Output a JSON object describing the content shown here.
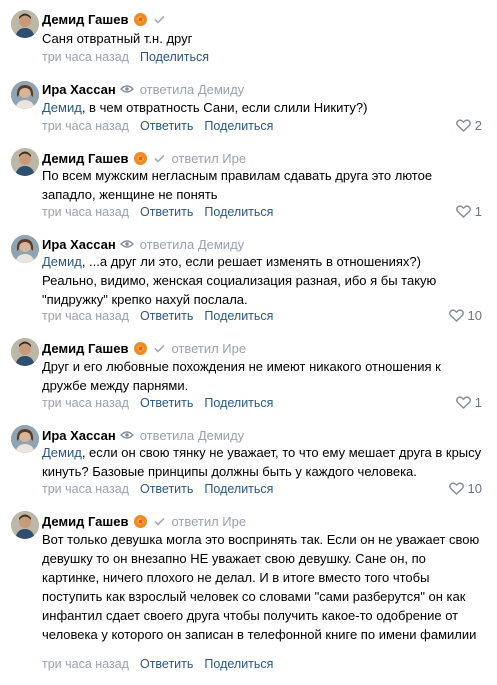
{
  "actions": {
    "reply_label": "Ответить",
    "share_label": "Поделиться"
  },
  "comments": [
    {
      "author": "Демид Гашев",
      "reply_to": "",
      "mention": "",
      "text": "Саня отвратный т.н. друг",
      "time": "три часа назад",
      "likes": ""
    },
    {
      "author": "Ира Хассан",
      "reply_to": "ответила Демиду",
      "mention": "Демид",
      "text": ", в чем отвратность Сани, если слили Никиту?)",
      "time": "три часа назад",
      "likes": "2"
    },
    {
      "author": "Демид Гашев",
      "reply_to": "ответил Ире",
      "mention": "",
      "text": "По всем мужским негласным правилам сдавать друга это лютое западло, женщине не понять",
      "time": "три часа назад",
      "likes": "1"
    },
    {
      "author": "Ира Хассан",
      "reply_to": "ответила Демиду",
      "mention": "Демид",
      "text": ", ...а друг ли это, если решает изменять в отношениях?)\nРеально, видимо, женская социализация разная, ибо я бы такую \"пидружку\" крепко нахуй послала.",
      "time": "три часа назад",
      "likes": "10"
    },
    {
      "author": "Демид Гашев",
      "reply_to": "ответил Ире",
      "mention": "",
      "text": "Друг и его любовные похождения не имеют никакого отношения к дружбе между парнями.",
      "time": "три часа назад",
      "likes": "1"
    },
    {
      "author": "Ира Хассан",
      "reply_to": "ответила Демиду",
      "mention": "Демид",
      "text": ", если он свою тянку не уважает, то что ему мешает друга в крысу кинуть? Базовые принципы должны быть у каждого человека.",
      "time": "три часа назад",
      "likes": "10"
    },
    {
      "author": "Демид Гашев",
      "reply_to": "ответил Ире",
      "mention": "",
      "text": "Вот только девушка могла это воспринять так. Если он не уважает свою девушку то он внезапно НЕ уважает свою девушку. Сане он, по картинке, ничего плохого не делал. И в итоге вместо того чтобы поступить как взрослый человек со словами \"сами разберутся\" он как инфантил сдает своего друга чтобы получить какое-то одобрение от человека у которого он записан в телефонной книге по имени фамилии",
      "time": "три часа назад",
      "likes": ""
    }
  ]
}
